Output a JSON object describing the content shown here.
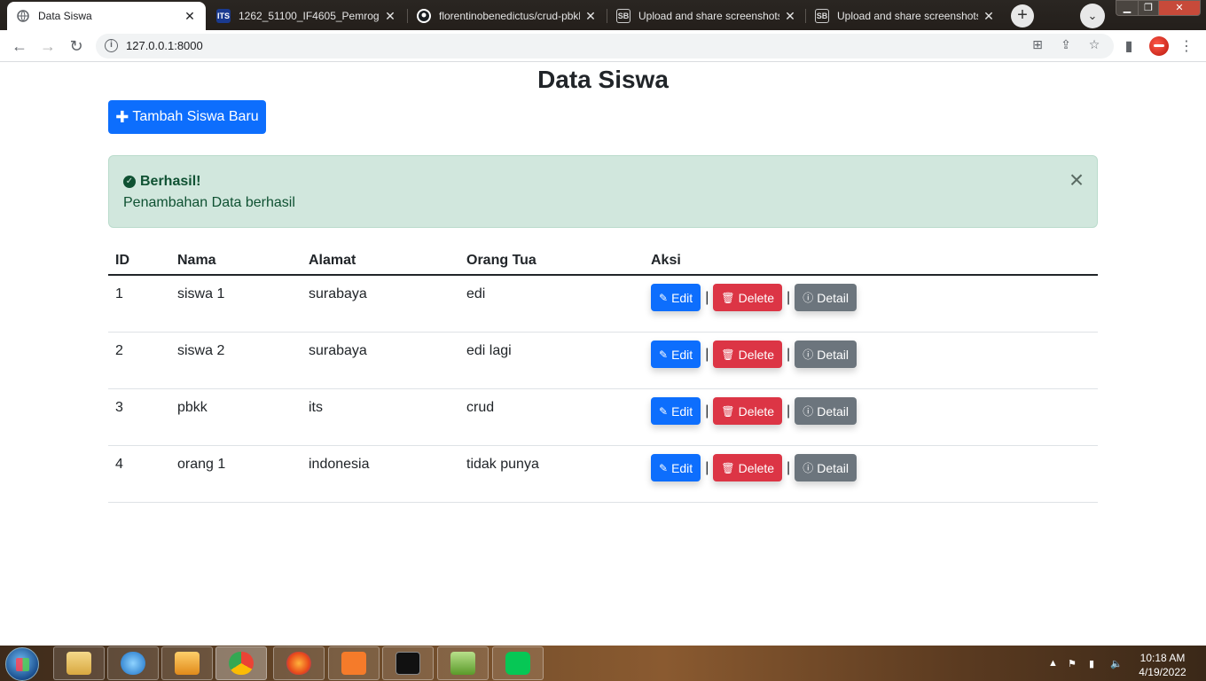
{
  "browser": {
    "tabs": [
      {
        "title": "Data Siswa",
        "icon": "globe-icon"
      },
      {
        "title": "1262_51100_IF4605_Pemrogra",
        "icon": "its-icon"
      },
      {
        "title": "florentinobenedictus/crud-pbkk",
        "icon": "github-icon"
      },
      {
        "title": "Upload and share screenshots",
        "icon": "sb-icon"
      },
      {
        "title": "Upload and share screenshots",
        "icon": "sb-icon"
      }
    ],
    "url": "127.0.0.1:8000"
  },
  "page": {
    "title": "Data Siswa",
    "add_button": "Tambah Siswa Baru",
    "alert": {
      "title": "Berhasil!",
      "message": "Penambahan Data berhasil"
    },
    "table": {
      "headers": [
        "ID",
        "Nama",
        "Alamat",
        "Orang Tua",
        "Aksi"
      ],
      "rows": [
        {
          "id": "1",
          "nama": "siswa 1",
          "alamat": "surabaya",
          "ortu": "edi"
        },
        {
          "id": "2",
          "nama": "siswa 2",
          "alamat": "surabaya",
          "ortu": "edi lagi"
        },
        {
          "id": "3",
          "nama": "pbkk",
          "alamat": "its",
          "ortu": "crud"
        },
        {
          "id": "4",
          "nama": "orang 1",
          "alamat": "indonesia",
          "ortu": "tidak punya"
        }
      ],
      "actions": {
        "edit": "Edit",
        "delete": "Delete",
        "detail": "Detail",
        "separator": "|"
      }
    }
  },
  "taskbar": {
    "time": "10:18 AM",
    "date": "4/19/2022"
  },
  "colors": {
    "primary": "#0d6efd",
    "danger": "#dc3545",
    "secondary": "#6c757d",
    "success_bg": "#d1e7dd",
    "success_text": "#0f5132"
  }
}
